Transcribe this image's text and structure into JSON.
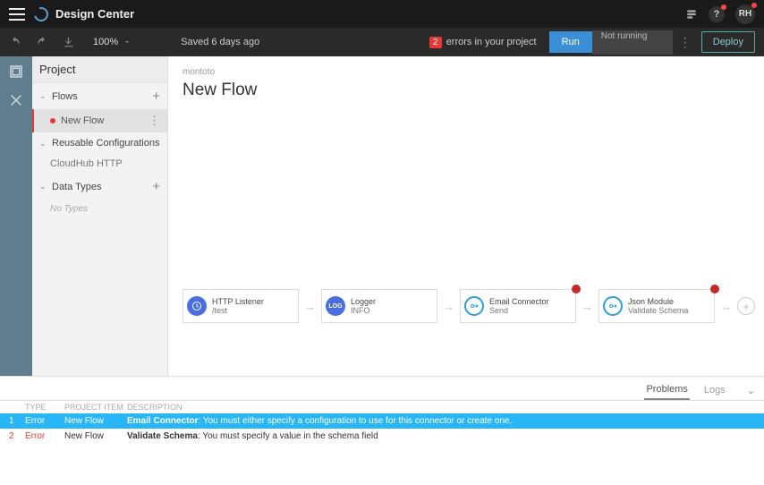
{
  "topbar": {
    "title": "Design Center",
    "avatar": "RH",
    "help": "?"
  },
  "actionbar": {
    "zoom": "100%",
    "saved": "Saved 6 days ago",
    "error_count": "2",
    "error_text": "errors in your project",
    "run": "Run",
    "status": "Not running",
    "deploy": "Deploy"
  },
  "sidebar": {
    "title": "Project",
    "sections": {
      "flows": {
        "label": "Flows",
        "items": [
          "New Flow"
        ]
      },
      "reusable": {
        "label": "Reusable Configurations",
        "items": [
          "CloudHub HTTP"
        ]
      },
      "datatypes": {
        "label": "Data Types",
        "empty": "No Types"
      }
    }
  },
  "canvas": {
    "crumb": "montoto",
    "title": "New Flow",
    "cards": [
      {
        "title": "HTTP Listener",
        "subtitle": "/test",
        "icon": "http",
        "style": "blue",
        "error": false
      },
      {
        "title": "Logger",
        "subtitle": "INFO",
        "icon": "logger",
        "style": "blue",
        "error": false
      },
      {
        "title": "Email Connector",
        "subtitle": "Send",
        "icon": "connector",
        "style": "ring",
        "error": true
      },
      {
        "title": "Json Module",
        "subtitle": "Validate Schema",
        "icon": "connector",
        "style": "ring",
        "error": true
      }
    ]
  },
  "bottom": {
    "tabs": {
      "problems": "Problems",
      "logs": "Logs"
    },
    "headers": {
      "type": "TYPE",
      "item": "PROJECT ITEM",
      "desc": "DESCRIPTION"
    },
    "rows": [
      {
        "n": "1",
        "type": "Error",
        "item": "New Flow",
        "name": "Email Connector",
        "msg": ": You must either specify a configuration to use for this connector or create one.",
        "selected": true
      },
      {
        "n": "2",
        "type": "Error",
        "item": "New Flow",
        "name": "Validate Schema",
        "msg": ": You must specify a value in the schema field",
        "selected": false
      }
    ]
  }
}
